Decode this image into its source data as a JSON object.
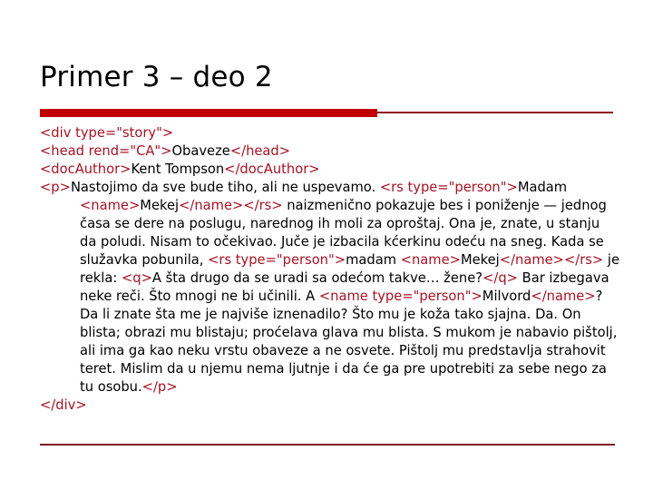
{
  "slide": {
    "title": "Primer 3 – deo 2",
    "accent_color": "#c00000",
    "tag_color": "#a51425",
    "text_color": "#000000",
    "background_color": "#ffffff",
    "rule_thin_color": "#8f1020",
    "bottom_rule_color": "#7e1526"
  },
  "content": {
    "line1": {
      "tag_open": "<div type=\"story\">"
    },
    "line2": {
      "tag_open": "<head rend=\"CA\">",
      "text": "Obaveze",
      "tag_close": "</head>"
    },
    "line3": {
      "tag_open": "<docAuthor>",
      "text": "Kent Tompson",
      "tag_close": "</docAuthor>"
    },
    "paragraph": {
      "tag_open": "<p>",
      "seg1_text": "Nastojimo da sve bude tiho, ali ne uspevamo. ",
      "seg2_tag": "<rs type=\"person\">",
      "seg3_text": "Madam ",
      "seg4_tag": "<name>",
      "seg5_text": "Mekej",
      "seg6_tag": "</name></rs>",
      "seg7_text": " naizmenično pokazuje bes i poniženje — jednog časa se dere na poslugu, narednog ih moli za oproštaj. Ona je, znate, u stanju da poludi. Nisam to očekivao. Juče je izbacila kćerkinu odeću na sneg. Kada se služavka pobunila, ",
      "seg8_tag": "<rs type=\"person\">",
      "seg9_text": "madam ",
      "seg10_tag": "<name>",
      "seg11_text": "Mekej",
      "seg12_tag": "</name></rs>",
      "seg13_text": " je rekla: ",
      "seg14_tag": "<q>",
      "seg15_text": "A šta drugo da se uradi sa odećom takve… žene?",
      "seg16_tag": "</q>",
      "seg17_text": " Bar izbegava neke reči. Što mnogi ne bi učinili. A ",
      "seg18_tag": "<name type=\"person\">",
      "seg19_text": "Milvord",
      "seg20_tag": "</name>",
      "seg21_text": "? Da li znate šta me je najviše iznenadilo? Što mu je koža tako sjajna. Da. On blista; obrazi mu blistaju; proćelava glava mu blista. S mukom je nabavio pištolj, ali ima ga kao neku vrstu obaveze a ne osvete. Pištolj mu predstavlja strahovit teret. Mislim da u njemu nema ljutnje i da će ga pre upotrebiti za sebe nego za tu osobu.",
      "tag_close": "</p>"
    },
    "line_last": {
      "tag_close": "</div>"
    }
  }
}
